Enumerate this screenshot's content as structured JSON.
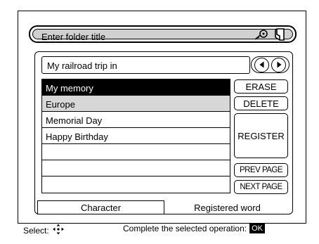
{
  "title_bar": {
    "label": "Enter folder title",
    "icons": [
      "key-icon",
      "document-icon"
    ]
  },
  "input": {
    "value": "My railroad trip in"
  },
  "arrows": {
    "prev_icon": "left-arrow-icon",
    "next_icon": "right-arrow-icon"
  },
  "list": {
    "items": [
      {
        "label": "My memory",
        "state": "selected"
      },
      {
        "label": "Europe",
        "state": "highlighted"
      },
      {
        "label": "Memorial Day",
        "state": "normal"
      },
      {
        "label": "Happy Birthday",
        "state": "normal"
      },
      {
        "label": "",
        "state": "normal"
      },
      {
        "label": "",
        "state": "normal"
      },
      {
        "label": "",
        "state": "normal"
      }
    ]
  },
  "buttons": {
    "erase": "ERASE",
    "delete": "DELETE",
    "register": "REGISTER",
    "prev_page": "PREV PAGE",
    "next_page": "NEXT PAGE"
  },
  "tabs": {
    "character": "Character",
    "registered_word": "Registered word"
  },
  "footer": {
    "select_label": "Select:",
    "select_icon": "dpad-icon",
    "complete_label": "Complete the selected operation:",
    "ok_label": "OK"
  }
}
